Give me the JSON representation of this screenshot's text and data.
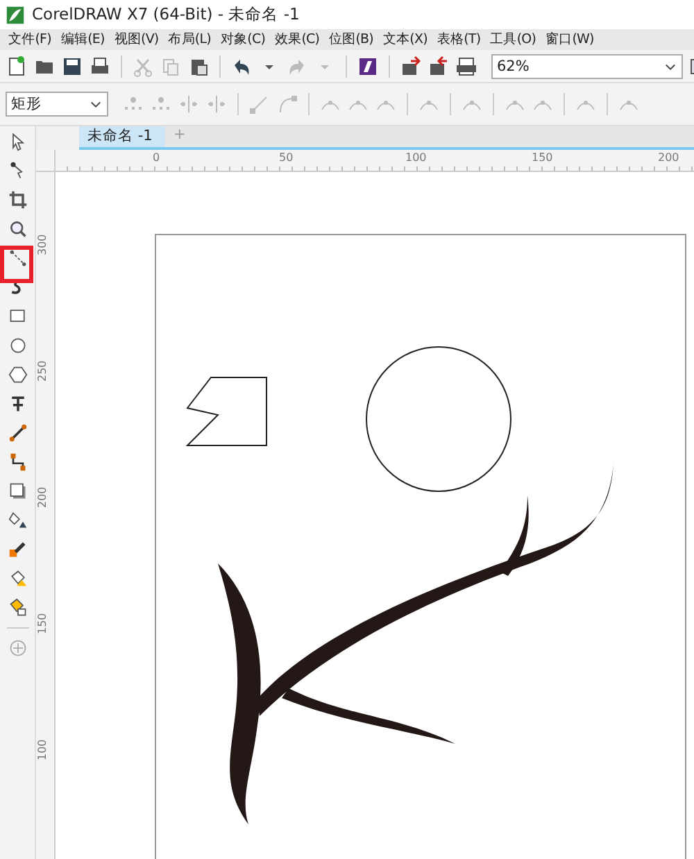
{
  "window": {
    "title": "CorelDRAW X7 (64-Bit) - 未命名 -1"
  },
  "menu": [
    "文件(F)",
    "编辑(E)",
    "视图(V)",
    "布局(L)",
    "对象(C)",
    "效果(C)",
    "位图(B)",
    "文本(X)",
    "表格(T)",
    "工具(O)",
    "窗口(W)"
  ],
  "toolbar": {
    "zoom": "62%"
  },
  "property_bar": {
    "shape": "矩形"
  },
  "tabs": [
    {
      "label": "未命名 -1",
      "selected": true
    },
    {
      "label": "+",
      "selected": false
    }
  ],
  "ruler": {
    "horizontal": [
      "0",
      "50",
      "100",
      "150",
      "200"
    ],
    "vertical": [
      "300",
      "250",
      "200",
      "150",
      "100"
    ]
  }
}
